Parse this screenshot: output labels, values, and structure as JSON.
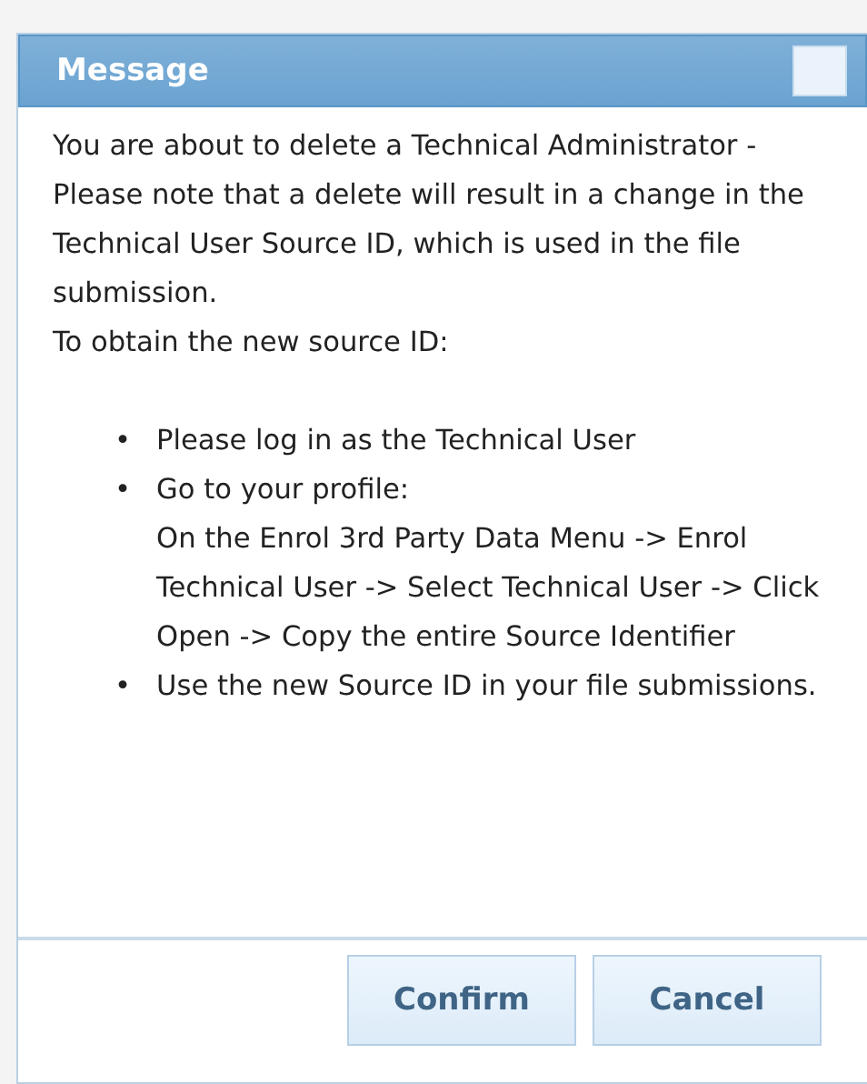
{
  "dialog": {
    "title": "Message",
    "paragraphs": [
      "You are about to delete a Technical Administrator - Please note that a delete will result in a change in the Technical User Source ID, which is used in the file submission.",
      "To obtain the new source ID:"
    ],
    "bullets": [
      {
        "marker": "•",
        "text": "Please log in as the Technical User"
      },
      {
        "marker": "•",
        "text": "Go to your profile:\nOn the Enrol 3rd Party Data Menu -> Enrol Technical User -> Select Technical User -> Click Open -> Copy the entire Source Identifier"
      },
      {
        "marker": "•",
        "text": "Use the new Source ID in your file submissions."
      }
    ],
    "buttons": [
      "Confirm",
      "Cancel"
    ]
  }
}
